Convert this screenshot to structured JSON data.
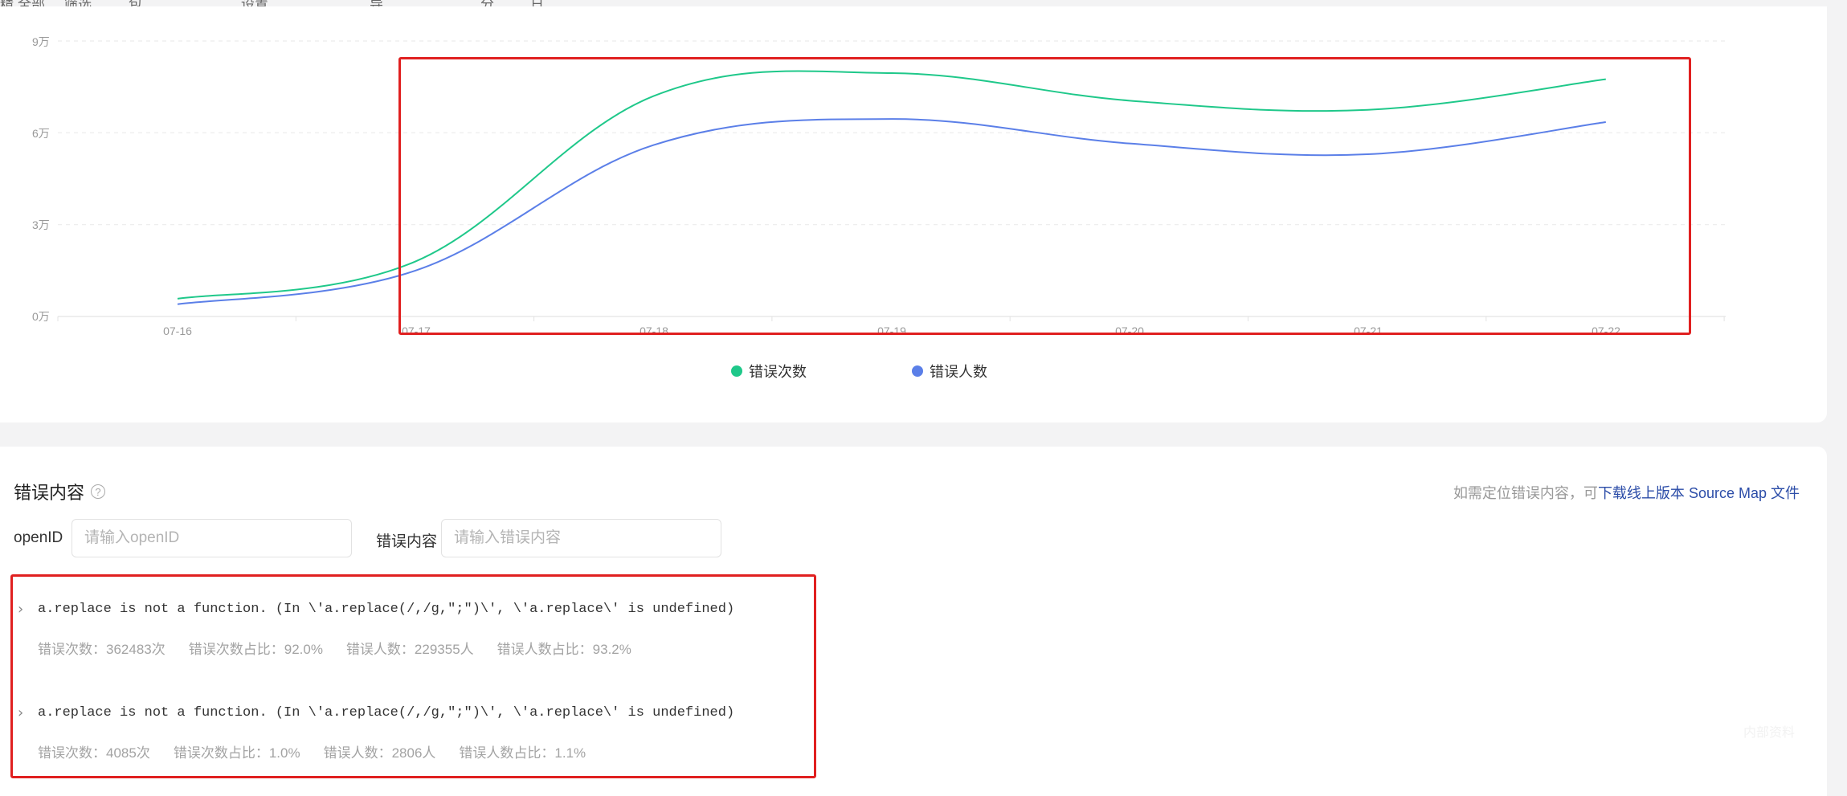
{
  "toolbar_fragments": [
    "精",
    "全部",
    "筛选",
    "包",
    "设置",
    "导",
    "分",
    "日"
  ],
  "chart_data": {
    "type": "line",
    "categories": [
      "07-16",
      "07-17",
      "07-18",
      "07-19",
      "07-20",
      "07-21",
      "07-22"
    ],
    "y_ticks": [
      "9万",
      "6万",
      "3万",
      "0万"
    ],
    "ylim": [
      0,
      90000
    ],
    "series": [
      {
        "name": "错误次数",
        "color": "#1fc88a",
        "values": [
          5800,
          18000,
          72000,
          79500,
          70500,
          67500,
          77500
        ]
      },
      {
        "name": "错误人数",
        "color": "#5b7fe8",
        "values": [
          4000,
          15000,
          56000,
          64500,
          56500,
          53000,
          63500
        ]
      }
    ],
    "grid": true,
    "legend_position": "bottom-center"
  },
  "errors_panel": {
    "title": "错误内容",
    "help_icon": "question-circle-icon",
    "hint_prefix": "如需定位错误内容，可",
    "hint_link": "下载线上版本 Source Map 文件",
    "filters": [
      {
        "label": "openID",
        "placeholder": "请输入openID",
        "value": ""
      },
      {
        "label": "错误内容",
        "placeholder": "请输入错误内容",
        "value": ""
      }
    ],
    "items": [
      {
        "message": "a.replace is not a function. (In \\'a.replace(/,/g,\";\")\\', \\'a.replace\\' is undefined)",
        "stats": [
          "错误次数：362483次",
          "错误次数占比：92.0%",
          "错误人数：229355人",
          "错误人数占比：93.2%"
        ]
      },
      {
        "message": "a.replace is not a function. (In \\'a.replace(/,/g,\";\")\\', \\'a.replace\\' is undefined)",
        "stats": [
          "错误次数：4085次",
          "错误次数占比：1.0%",
          "错误人数：2806人",
          "错误人数占比：1.1%"
        ]
      }
    ]
  },
  "watermark": "内部资料"
}
